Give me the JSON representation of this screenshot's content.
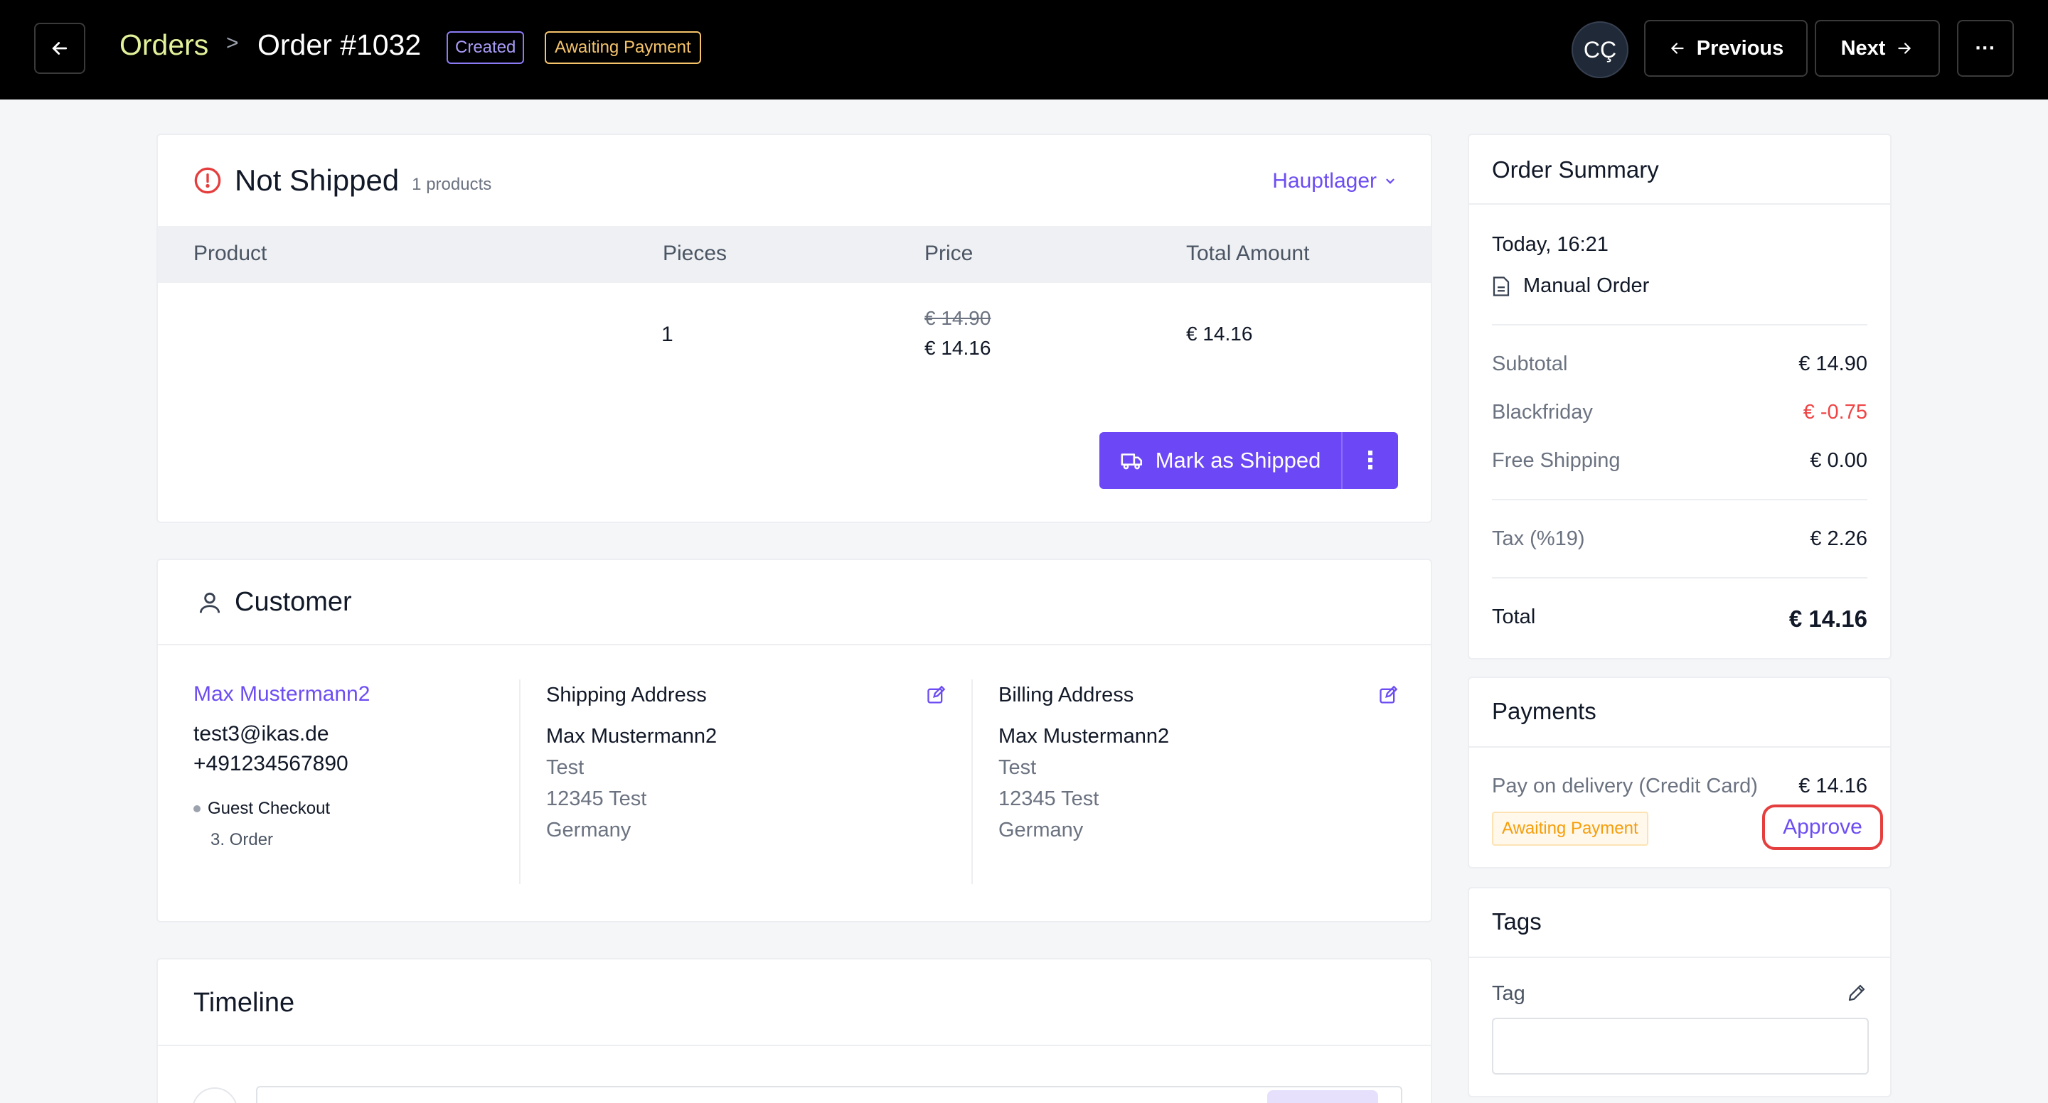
{
  "header": {
    "breadcrumb_root": "Orders",
    "breadcrumb_separator": ">",
    "order_title": "Order #1032",
    "status_created": "Created",
    "status_payment": "Awaiting Payment",
    "avatar_initials": "CÇ",
    "previous_label": "Previous",
    "next_label": "Next",
    "more_label": "···"
  },
  "shipment": {
    "title": "Not Shipped",
    "count": "1 products",
    "warehouse": "Hauptlager",
    "columns": [
      "Product",
      "Pieces",
      "Price",
      "Total Amount"
    ],
    "row": {
      "product": "",
      "pieces": "1",
      "old_price": "€ 14.90",
      "price": "€ 14.16",
      "total": "€ 14.16"
    },
    "ship_button": "Mark as Shipped",
    "ship_more": "⋮"
  },
  "customer": {
    "title": "Customer",
    "name": "Max Mustermann2",
    "email": "test3@ikas.de",
    "phone": "+491234567890",
    "checkout": "Guest Checkout",
    "order_count": "3. Order",
    "shipping": {
      "title": "Shipping Address",
      "name": "Max Mustermann2",
      "line1": "Test",
      "line2": "12345 Test",
      "country": "Germany"
    },
    "billing": {
      "title": "Billing Address",
      "name": "Max Mustermann2",
      "line1": "Test",
      "line2": "12345 Test",
      "country": "Germany"
    }
  },
  "timeline": {
    "title": "Timeline"
  },
  "summary": {
    "title": "Order Summary",
    "date": "Today, 16:21",
    "source": "Manual Order",
    "subtotal_label": "Subtotal",
    "subtotal": "€ 14.90",
    "discount_label": "Blackfriday",
    "discount": "€ -0.75",
    "shipping_label": "Free Shipping",
    "shipping": "€ 0.00",
    "tax_label": "Tax (%19)",
    "tax": "€ 2.26",
    "total_label": "Total",
    "total": "€ 14.16"
  },
  "payments": {
    "title": "Payments",
    "method": "Pay on delivery (Credit Card)",
    "amount": "€ 14.16",
    "status": "Awaiting Payment",
    "approve": "Approve"
  },
  "tags": {
    "title": "Tags",
    "label": "Tag",
    "value": ""
  },
  "colors": {
    "accent": "#6c47f5",
    "breadcrumb": "#e2f29a",
    "warning": "#f5c46b",
    "danger": "#ef4444"
  }
}
